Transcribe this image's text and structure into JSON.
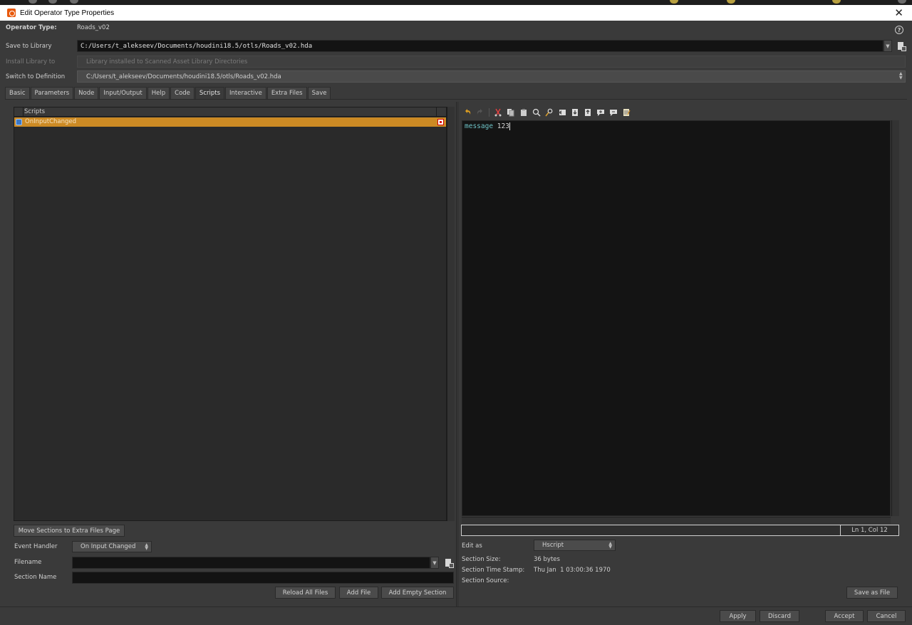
{
  "window": {
    "title": "Edit Operator Type Properties",
    "close_glyph": "✕"
  },
  "header": {
    "operator_type_label": "Operator Type:",
    "operator_type_value": "Roads_v02",
    "help_glyph": "?",
    "save_to_library_label": "Save to Library",
    "save_to_library_value": "C:/Users/t_alekseev/Documents/houdini18.5/otls/Roads_v02.hda",
    "install_library_label": "Install Library to",
    "install_library_value": "Library installed to Scanned Asset Library Directories",
    "switch_definition_label": "Switch to Definition",
    "switch_definition_value": "C:/Users/t_alekseev/Documents/houdini18.5/otls/Roads_v02.hda"
  },
  "tabs": [
    "Basic",
    "Parameters",
    "Node",
    "Input/Output",
    "Help",
    "Code",
    "Scripts",
    "Interactive",
    "Extra Files",
    "Save"
  ],
  "active_tab": "Scripts",
  "scripts_panel": {
    "list_header": "Scripts",
    "items": [
      {
        "label": "OnInputChanged",
        "selected": true
      }
    ],
    "move_button": "Move Sections to Extra Files Page",
    "event_handler_label": "Event Handler",
    "event_handler_value": "On Input Changed",
    "filename_label": "Filename",
    "filename_value": "",
    "section_name_label": "Section Name",
    "section_name_value": "",
    "reload_button": "Reload All Files",
    "add_file_button": "Add File",
    "add_empty_button": "Add Empty Section"
  },
  "editor": {
    "keyword": "message",
    "text": " 123",
    "cursor_position": "Ln 1, Col 12",
    "edit_as_label": "Edit as",
    "edit_as_value": "Hscript",
    "section_size_label": "Section Size:",
    "section_size_value": "36 bytes",
    "timestamp_label": "Section Time Stamp:",
    "timestamp_value": "Thu Jan  1 03:00:36 1970",
    "source_label": "Section Source:",
    "source_value": "",
    "save_as_file_button": "Save as File"
  },
  "footer": {
    "apply": "Apply",
    "discard": "Discard",
    "accept": "Accept",
    "cancel": "Cancel"
  },
  "colors": {
    "selection": "#cc8a24",
    "keyword": "#6ec2c6",
    "app_icon": "#e8590c"
  },
  "toolbar_icons": [
    "undo-icon",
    "redo-icon",
    "cut-icon",
    "copy-icon",
    "paste-icon",
    "find-icon",
    "replace-icon",
    "indent-icon",
    "import-icon",
    "export-icon",
    "comment-icon",
    "uncomment-icon",
    "notes-icon"
  ]
}
